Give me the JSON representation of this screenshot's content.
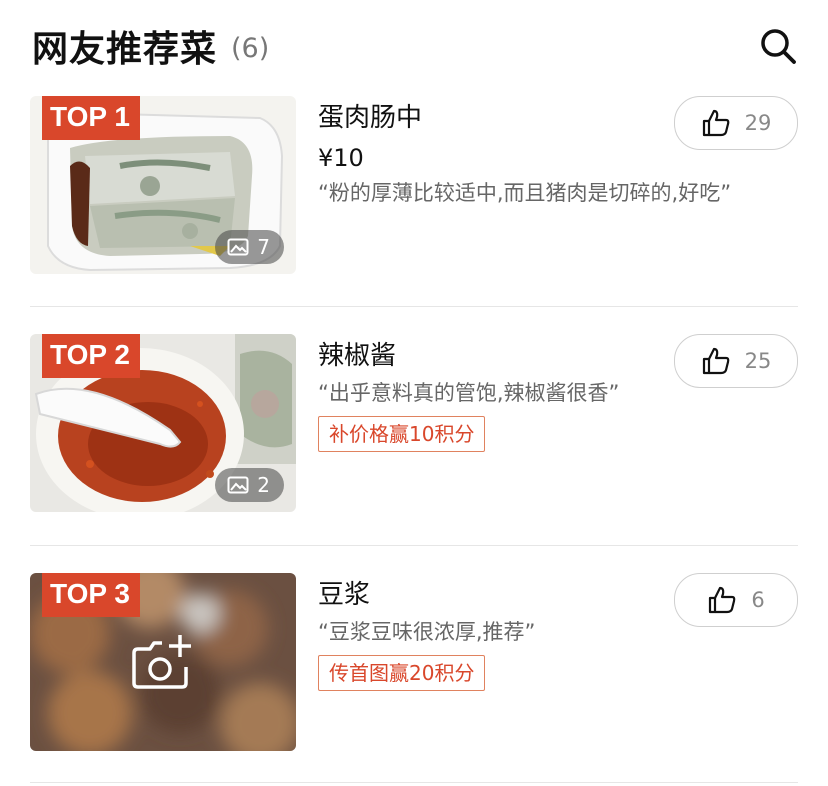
{
  "header": {
    "title": "网友推荐菜",
    "count": "(6)",
    "search_icon": "search-icon"
  },
  "accent_color": "#d9472b",
  "items": [
    {
      "rank": "TOP 1",
      "name": "蛋肉肠中",
      "price": "¥10",
      "quote": "“粉的厚薄比较适中,而且猪肉是切碎的,好吃”",
      "photo_count": "7",
      "likes": "29",
      "tag": ""
    },
    {
      "rank": "TOP 2",
      "name": "辣椒酱",
      "price": "",
      "quote": "“出乎意料真的管饱,辣椒酱很香”",
      "photo_count": "2",
      "likes": "25",
      "tag": "补价格赢10积分"
    },
    {
      "rank": "TOP 3",
      "name": "豆浆",
      "price": "",
      "quote": "“豆浆豆味很浓厚,推荐”",
      "photo_count": "",
      "likes": "6",
      "tag": "传首图赢20积分"
    }
  ]
}
